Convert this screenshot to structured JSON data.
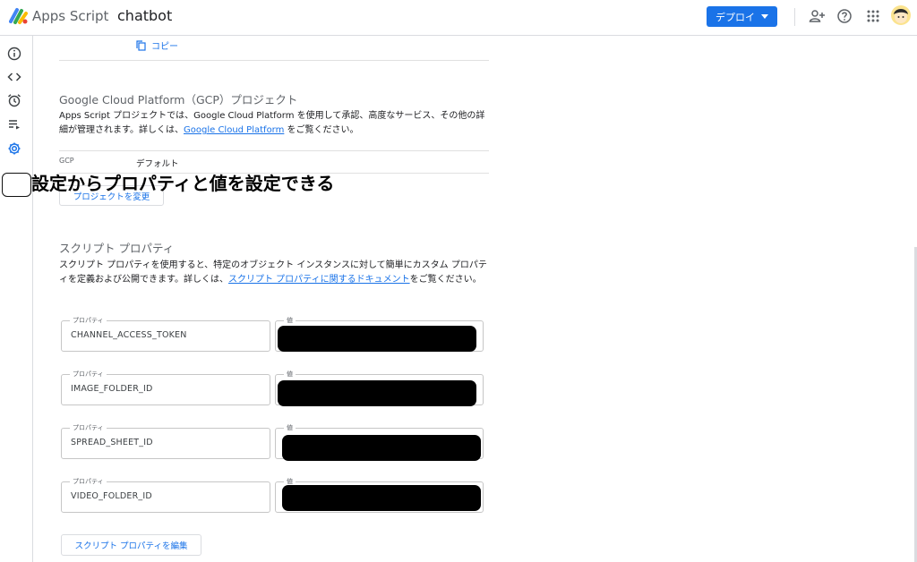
{
  "header": {
    "app_name": "Apps Script",
    "project_name": "chatbot",
    "deploy_label": "デプロイ",
    "icons": [
      "add-person-icon",
      "help-icon",
      "apps-grid-icon"
    ]
  },
  "sidebar": {
    "items": [
      {
        "name": "overview",
        "icon": "info-icon"
      },
      {
        "name": "editor",
        "icon": "code-icon"
      },
      {
        "name": "triggers",
        "icon": "alarm-clock-icon"
      },
      {
        "name": "executions",
        "icon": "list-run-icon"
      },
      {
        "name": "settings",
        "icon": "gear-icon",
        "selected": true
      }
    ]
  },
  "copy_label": "コピー",
  "gcp": {
    "title": "Google Cloud Platform（GCP）プロジェクト",
    "desc_before": "Apps Script プロジェクトでは、Google Cloud Platform を使用して承認、高度なサービス、その他の詳細が管理されます。詳しくは、",
    "desc_link": "Google Cloud Platform",
    "desc_after": " をご覧ください。",
    "label": "GCP",
    "value": "デフォルト",
    "change_button": "プロジェクトを変更"
  },
  "annotation": "設定からプロパティと値を設定できる",
  "script_properties": {
    "title": "スクリプト プロパティ",
    "desc_before": "スクリプト プロパティを使用すると、特定のオブジェクト インスタンスに対して簡単にカスタム プロパティを定義および公開できます。詳しくは、",
    "desc_link": "スクリプト プロパティに関するドキュメント",
    "desc_after": "をご覧ください。",
    "property_label": "プロパティ",
    "value_label": "値",
    "properties": [
      {
        "key": "CHANNEL_ACCESS_TOKEN"
      },
      {
        "key": "IMAGE_FOLDER_ID"
      },
      {
        "key": "SPREAD_SHEET_ID"
      },
      {
        "key": "VIDEO_FOLDER_ID"
      }
    ],
    "edit_button": "スクリプト プロパティを編集"
  },
  "colors": {
    "accent": "#1a73e8",
    "redaction": "#000000"
  }
}
